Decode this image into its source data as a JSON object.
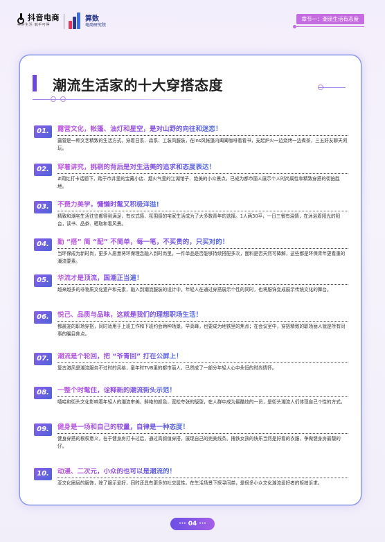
{
  "header": {
    "logo1_text": "抖音电商",
    "logo1_sub": "美好生活 触手可得",
    "logo2_text": "算数",
    "logo2_sub": "电商研究院",
    "chapter": "章节一：潮流生活有态度",
    "brand_colors": {
      "accent": "#c56de0",
      "title_bar": "#6f45e0",
      "number_badge": "#6b5ae6"
    }
  },
  "page": {
    "title": "潮流生活家的十大穿搭态度",
    "page_number": "04"
  },
  "items": [
    {
      "num": "01.",
      "heading": "露营文化，帐篷、油灯和星空，是对山野的向往和迷恋！",
      "body": "露营是一种文艺精致的生活方式，穿着日系、森系、工装风服装，在ins风帐篷内阖阖咖啡看看书，支起炉火一边烧烤一边煮茶，三五好友聊天闲玩。"
    },
    {
      "num": "02.",
      "heading": "穿着讲究，挑剔的背后是对生活美的追求和态度表达！",
      "body": "#网红打卡话题下，踏于市井里的宝藏小店、烟火气里的江湖馆子、绝美的小众景点，已成为都市丽人展示个人时尚属性和精致穿搭的街拍胜地。"
    },
    {
      "num": "03.",
      "heading": "不费力美学，慵懒时髦又积极洋溢!",
      "body": "精致和潮宅生活往往都得到满足，有仪式感、氛围感的宅家生活成为了大多数青年的选择。1人两30平，一日三餐有温情，在沐浴着阳光的阳台，读书、品茶、晒取和看风景。"
    },
    {
      "num": "04.",
      "heading": "勤 “搭” 简 “配” 不简单，每一笔，不买贵的，只买对的！",
      "body": "当环保成为新时尚，更多人愿意将环保理念融入到时尚里。一件单品是否能够持续搭配多次，面料是否天然可降解，这些都是环保青年更看重的潮流要素。"
    },
    {
      "num": "05.",
      "heading": "华流才是顶流，国潮正当道！",
      "body": "越来越多的非物质文化遗产和元素，融入到潮流服装的设计中，年轻人在通过穿搭展示个性的同时，也将服饰变成展示传统文化的舞台。"
    },
    {
      "num": "06.",
      "heading": "悦己、品质与品味，这就是我们的理想职场生活！",
      "body": "都晨宠的职场穿搭，同时适用于上班工作和下班约会两种场景。早高峰，也要成为地铁里的焦点；在会议室中，穿搭精致的职场丽人就是所有同事的瞩目焦点。"
    },
    {
      "num": "07.",
      "heading": "潮流是个轮回，把 “爷青回” 打在公屏上！",
      "body": "复古港风是潮流服务不过时的风格，童年时TVB里的都市丽人，已然成了一部分年轻人心中永恒的时尚情怀。"
    },
    {
      "num": "08.",
      "heading": "一整个时髦住，诠释新的潮流街头示范！",
      "body": "嘻哈和街头文化影响着年轻人的潮流审美，鲜艳的颜色，宽松夸张的版型，在人群中成为最酷炫的一员，是街头潮流人们体现自己个性的方式。"
    },
    {
      "num": "09.",
      "heading": "健身是一场和自己的较量，自律是一种态度！",
      "body": "健身穿搭的根权意义，在于健身房打卡过后，通过高颜值穿搭，展现自己的完美线条。撸铁女孩的快乐当然是好看的衣服，争做健身房最靓的仔。"
    },
    {
      "num": "10.",
      "heading": "动漫、二次元，小众的也可以是潮流的！",
      "body": "亚文化圈层的服饰，除了服示爱好，同时还具有更多的社交属性。在生活场景下探寻同类，是很多小众文化潮流爱好者的矩拍诉求。"
    }
  ]
}
